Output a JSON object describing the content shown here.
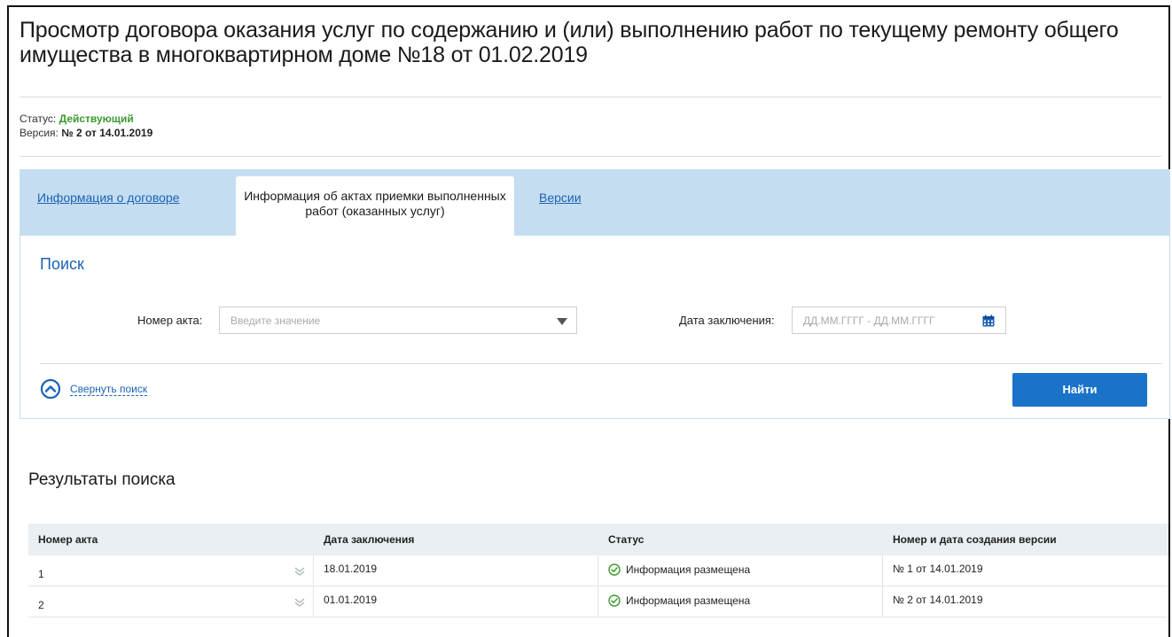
{
  "page": {
    "title": "Просмотр договора оказания услуг по содержанию и (или) выполнению работ по текущему ремонту общего имущества в многоквартирном доме №18 от 01.02.2019"
  },
  "meta": {
    "status_label": "Статус:",
    "status_value": "Действующий",
    "version_label": "Версия:",
    "version_value": "№ 2 от 14.01.2019"
  },
  "tabs": {
    "contract_info": "Информация о договоре",
    "acts_info": "Информация об актах приемки выполненных работ (оказанных услуг)",
    "versions": "Версии"
  },
  "search": {
    "title": "Поиск",
    "act_number_label": "Номер акта:",
    "act_number_placeholder": "Введите значение",
    "date_label": "Дата заключения:",
    "date_placeholder": "ДД.ММ.ГГГГ - ДД.ММ.ГГГГ",
    "collapse_label": "Свернуть поиск",
    "find_button": "Найти"
  },
  "results": {
    "title": "Результаты поиска",
    "columns": [
      "Номер акта",
      "Дата заключения",
      "Статус",
      "Номер и дата создания версии"
    ],
    "rows": [
      {
        "act_number": "1",
        "date": "18.01.2019",
        "status": "Информация размещена",
        "version": "№ 1 от 14.01.2019"
      },
      {
        "act_number": "2",
        "date": "01.01.2019",
        "status": "Информация размещена",
        "version": "№ 2 от 14.01.2019"
      }
    ]
  },
  "colors": {
    "accent": "#1b63b3",
    "button": "#1a73c9",
    "status_active": "#3a9a2d",
    "tab_bar": "#c5ddf1"
  }
}
